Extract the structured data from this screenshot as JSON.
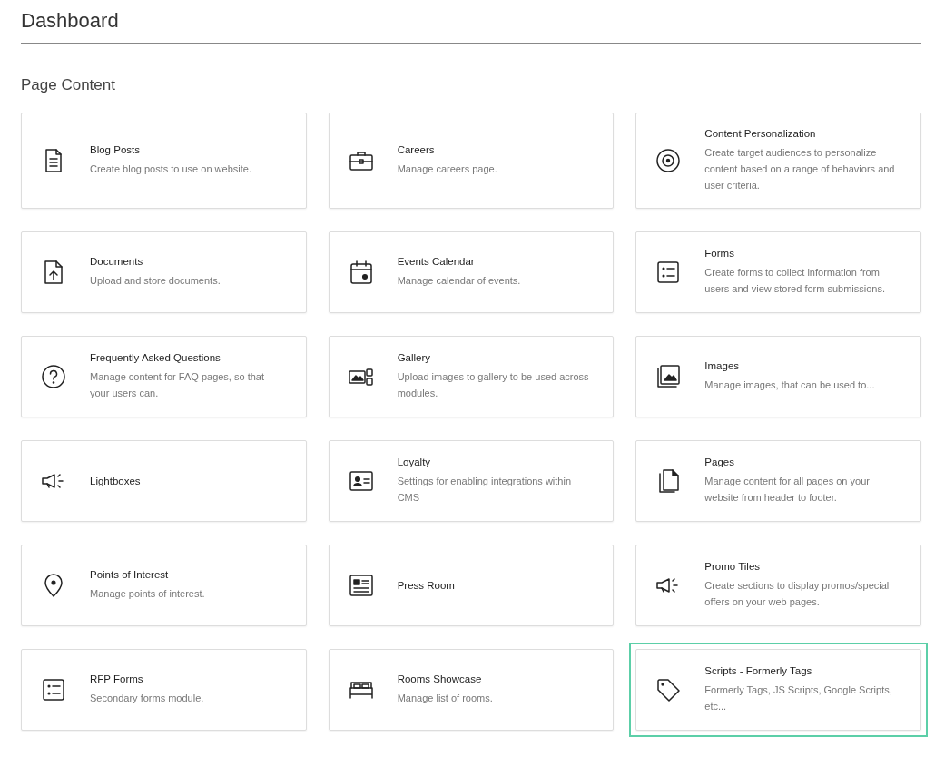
{
  "page_title": "Dashboard",
  "section_title": "Page Content",
  "cards": [
    {
      "kind": "document",
      "title": "Blog Posts",
      "description": "Create blog posts to use on website.",
      "selected": false
    },
    {
      "kind": "briefcase",
      "title": "Careers",
      "description": "Manage careers page.",
      "selected": false
    },
    {
      "kind": "target",
      "title": "Content Personalization",
      "description": "Create target audiences to personalize content based on a range of behaviors and user criteria.",
      "selected": false
    },
    {
      "kind": "upload",
      "title": "Documents",
      "description": "Upload and store documents.",
      "selected": false
    },
    {
      "kind": "calendar",
      "title": "Events Calendar",
      "description": "Manage calendar of events.",
      "selected": false
    },
    {
      "kind": "list",
      "title": "Forms",
      "description": "Create forms to collect information from users and view stored form submissions.",
      "selected": false
    },
    {
      "kind": "question",
      "title": "Frequently Asked Questions",
      "description": "Manage content for FAQ pages, so that your users can.",
      "selected": false
    },
    {
      "kind": "gallery",
      "title": "Gallery",
      "description": "Upload images to gallery to be used across modules.",
      "selected": false
    },
    {
      "kind": "images",
      "title": "Images",
      "description": "Manage images, that can be used to...",
      "selected": false
    },
    {
      "kind": "megaphone",
      "title": "Lightboxes",
      "selected": false
    },
    {
      "kind": "idcard",
      "title": "Loyalty",
      "description": "Settings for enabling integrations within CMS",
      "selected": false
    },
    {
      "kind": "pages",
      "title": "Pages",
      "description": "Manage content for all pages on your website from header to footer.",
      "selected": false
    },
    {
      "kind": "pin",
      "title": "Points of Interest",
      "description": "Manage points of interest.",
      "selected": false
    },
    {
      "kind": "news",
      "title": "Press Room",
      "selected": false
    },
    {
      "kind": "megaphone",
      "title": "Promo Tiles",
      "description": "Create sections to display promos/special offers on your web pages.",
      "selected": false
    },
    {
      "kind": "list",
      "title": "RFP Forms",
      "description": "Secondary forms module.",
      "selected": false
    },
    {
      "kind": "bed",
      "title": "Rooms Showcase",
      "description": "Manage list of rooms.",
      "selected": false
    },
    {
      "kind": "tag",
      "title": "Scripts - Formerly Tags",
      "description": "Formerly Tags, JS Scripts, Google Scripts, etc...",
      "selected": true
    }
  ]
}
